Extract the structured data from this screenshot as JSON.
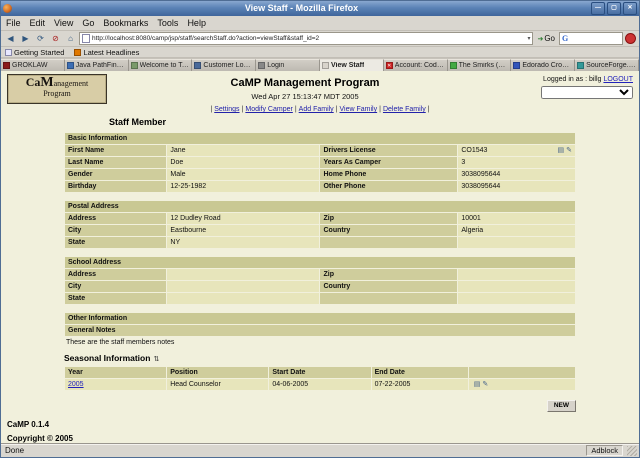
{
  "window": {
    "title": "View Staff - Mozilla Firefox",
    "controls": {
      "minimize": "—",
      "maximize": "▢",
      "close": "✕"
    }
  },
  "icons": {
    "back": "◀",
    "forward": "▶",
    "reload": "⟳",
    "stop": "⊘",
    "home": "⌂",
    "go": "➜",
    "dropdown_arrow": "▾",
    "sheet": "▤",
    "edit": "✎",
    "sort": "⇅"
  },
  "menubar": [
    "File",
    "Edit",
    "View",
    "Go",
    "Bookmarks",
    "Tools",
    "Help"
  ],
  "navbar": {
    "url": "http://localhost:8080/camp/jsp/staff/searchStaff.do?action=viewStaff&staff_id=2",
    "go_label": "Go",
    "search_icon_letter": "G"
  },
  "bookmarks_bar": [
    "Getting Started",
    "Latest Headlines"
  ],
  "tabs": [
    {
      "label": "GROKLAW",
      "icon_color": "#8b1a1a",
      "active": false
    },
    {
      "label": "Java PathFinder",
      "icon_color": "#3c6eb4",
      "active": false
    },
    {
      "label": "Welcome to TestT...",
      "icon_color": "#7a9a6a",
      "active": false
    },
    {
      "label": "Customer Login: R...",
      "icon_color": "#4a6a9a",
      "active": false
    },
    {
      "label": "Login",
      "icon_color": "#888888",
      "active": false
    },
    {
      "label": "View Staff",
      "icon_color": "#d8d4cc",
      "active": true
    },
    {
      "label": "Account: CodeCon...",
      "icon_color": "#cc2222",
      "icon_glyph": "✕",
      "active": false
    },
    {
      "label": "The Smirks (Framew...",
      "icon_color": "#44aa44",
      "active": false
    },
    {
      "label": "Edorado Crossroa...",
      "icon_color": "#3355bb",
      "active": false
    },
    {
      "label": "SourceForge.net v...",
      "icon_color": "#339999",
      "active": false
    }
  ],
  "page": {
    "title": "CaMP Management Program",
    "date": "Wed Apr 27 15:13:47 MDT 2005",
    "logo": {
      "prefix": "Ca",
      "big": "M",
      "suffix": "anagement",
      "line2": "Program"
    },
    "logged_in_label": "Logged in as : billg",
    "logout_label": "LOGOUT",
    "link_separator": "|",
    "nav_links": [
      "Settings",
      "Modify Camper",
      "Add Family",
      "View Family",
      "Delete Family"
    ],
    "heading": "Staff Member",
    "basic_info": {
      "title": "Basic Information",
      "rows": [
        {
          "l1": "First Name",
          "v1": "Jane",
          "l2": "Drivers License",
          "v2": "CO1543",
          "has_icons": true
        },
        {
          "l1": "Last Name",
          "v1": "Doe",
          "l2": "Years As Camper",
          "v2": "3"
        },
        {
          "l1": "Gender",
          "v1": "Male",
          "l2": "Home Phone",
          "v2": "3038095644"
        },
        {
          "l1": "Birthday",
          "v1": "12-25-1982",
          "l2": "Other Phone",
          "v2": "3038095644"
        }
      ]
    },
    "postal_address": {
      "title": "Postal Address",
      "rows": [
        {
          "l1": "Address",
          "v1": "12 Dudley Road",
          "l2": "Zip",
          "v2": "10001"
        },
        {
          "l1": "City",
          "v1": "Eastbourne",
          "l2": "Country",
          "v2": "Algeria"
        },
        {
          "l1": "State",
          "v1": "NY",
          "l2": "",
          "v2": ""
        }
      ]
    },
    "school_address": {
      "title": "School Address",
      "rows": [
        {
          "l1": "Address",
          "v1": "",
          "l2": "Zip",
          "v2": ""
        },
        {
          "l1": "City",
          "v1": "",
          "l2": "Country",
          "v2": ""
        },
        {
          "l1": "State",
          "v1": "",
          "l2": "",
          "v2": ""
        }
      ]
    },
    "other_info": {
      "title": "Other Information",
      "notes_label": "General Notes",
      "notes_text": "These are the staff members notes"
    },
    "seasonal": {
      "title": "Seasonal Information",
      "headers": [
        "Year",
        "Position",
        "Start Date",
        "End Date",
        ""
      ],
      "rows": [
        [
          "2005",
          "Head Counselor",
          "04-06-2005",
          "07-22-2005"
        ]
      ],
      "new_button": "NEW"
    },
    "footer": {
      "version": "CaMP 0.1.4",
      "copyright": "Copyright © 2005"
    }
  },
  "statusbar": {
    "left": "Done",
    "right": "Adblock"
  }
}
